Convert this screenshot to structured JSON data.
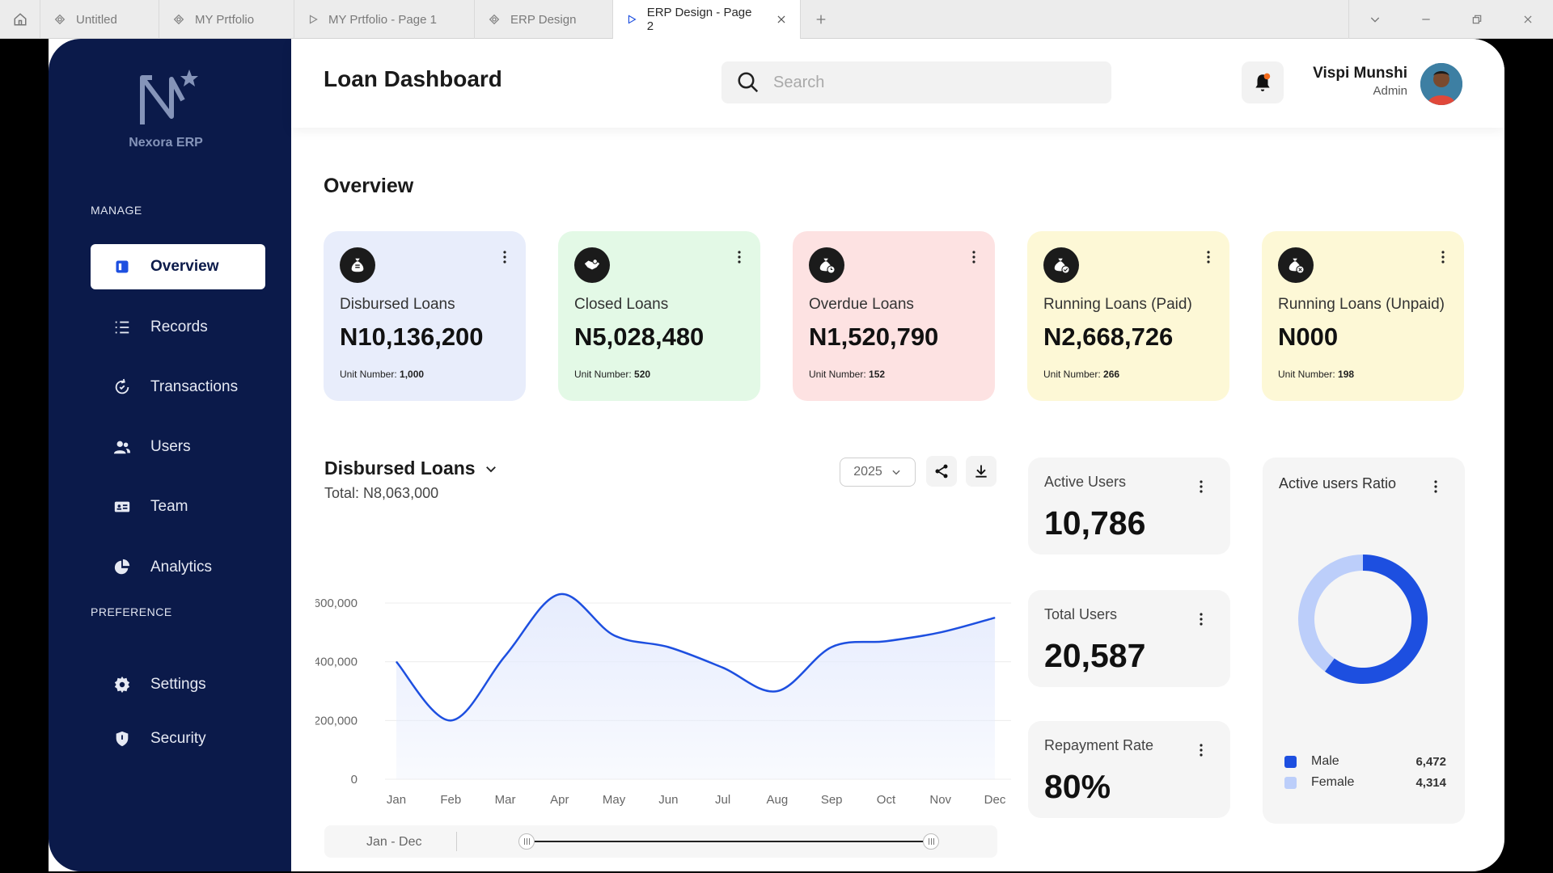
{
  "browser": {
    "tabs": [
      {
        "label": "Untitled",
        "icon": "figma-file-icon"
      },
      {
        "label": "MY Prtfolio",
        "icon": "figma-file-icon"
      },
      {
        "label": "MY Prtfolio - Page 1",
        "icon": "play-icon"
      },
      {
        "label": "ERP Design",
        "icon": "figma-file-icon"
      },
      {
        "label": "ERP Design - Page 2",
        "icon": "play-icon",
        "active": true
      }
    ]
  },
  "sidebar": {
    "logo_text": "Nexora ERP",
    "section_manage": "MANAGE",
    "section_preference": "PREFERENCE",
    "items": [
      {
        "label": "Overview",
        "icon": "overview-icon",
        "active": true
      },
      {
        "label": "Records",
        "icon": "list-icon"
      },
      {
        "label": "Transactions",
        "icon": "transactions-icon"
      },
      {
        "label": "Users",
        "icon": "users-icon"
      },
      {
        "label": "Team",
        "icon": "id-card-icon"
      },
      {
        "label": "Analytics",
        "icon": "pie-chart-icon"
      },
      {
        "label": "Settings",
        "icon": "gear-icon"
      },
      {
        "label": "Security",
        "icon": "shield-icon"
      }
    ]
  },
  "header": {
    "title": "Loan Dashboard",
    "search_placeholder": "Search",
    "user_name": "Vispi Munshi",
    "user_role": "Admin"
  },
  "overview": {
    "title": "Overview",
    "unit_label": "Unit Number:",
    "cards": [
      {
        "label": "Disbursed Loans",
        "value": "N10,136,200",
        "unit": "1,000",
        "bg": "#e8edfb",
        "icon": "money-bag-icon"
      },
      {
        "label": "Closed Loans",
        "value": "N5,028,480",
        "unit": "520",
        "bg": "#e3f9e6",
        "icon": "handshake-icon"
      },
      {
        "label": "Overdue Loans",
        "value": "N1,520,790",
        "unit": "152",
        "bg": "#fde2e2",
        "icon": "money-bag-clock-icon"
      },
      {
        "label": "Running Loans (Paid)",
        "value": "N2,668,726",
        "unit": "266",
        "bg": "#fdf8d6",
        "icon": "money-bag-check-icon"
      },
      {
        "label": "Running Loans (Unpaid)",
        "value": "N000",
        "unit": "198",
        "bg": "#fdf8d6",
        "icon": "money-bag-x-icon"
      }
    ]
  },
  "disbursed_chart": {
    "title": "Disbursed Loans",
    "total": "Total: N8,063,000",
    "year": "2025",
    "range_label": "Jan - Dec"
  },
  "chart_data": {
    "type": "area",
    "categories": [
      "Jan",
      "Feb",
      "Mar",
      "Apr",
      "May",
      "Jun",
      "Jul",
      "Aug",
      "Sep",
      "Oct",
      "Nov",
      "Dec"
    ],
    "values": [
      400000,
      200000,
      420000,
      630000,
      490000,
      450000,
      380000,
      300000,
      450000,
      470000,
      500000,
      550000
    ],
    "yticks": [
      "600,000",
      "400,000",
      "200,000",
      "0"
    ],
    "ytick_values": [
      600000,
      400000,
      200000,
      0
    ],
    "ylim": [
      0,
      600000
    ],
    "grid": true,
    "line_color": "#1d4fe0",
    "fill_color": "#e6ecfd"
  },
  "stats": [
    {
      "label": "Active Users",
      "value": "10,786"
    },
    {
      "label": "Total Users",
      "value": "20,587"
    },
    {
      "label": "Repayment Rate",
      "value": "80%"
    }
  ],
  "ratio": {
    "title": "Active users Ratio",
    "segments": [
      {
        "name": "Male",
        "value": 6472,
        "display": "6,472",
        "color": "#1d4fe0"
      },
      {
        "name": "Female",
        "value": 4314,
        "display": "4,314",
        "color": "#bccefa"
      }
    ]
  }
}
